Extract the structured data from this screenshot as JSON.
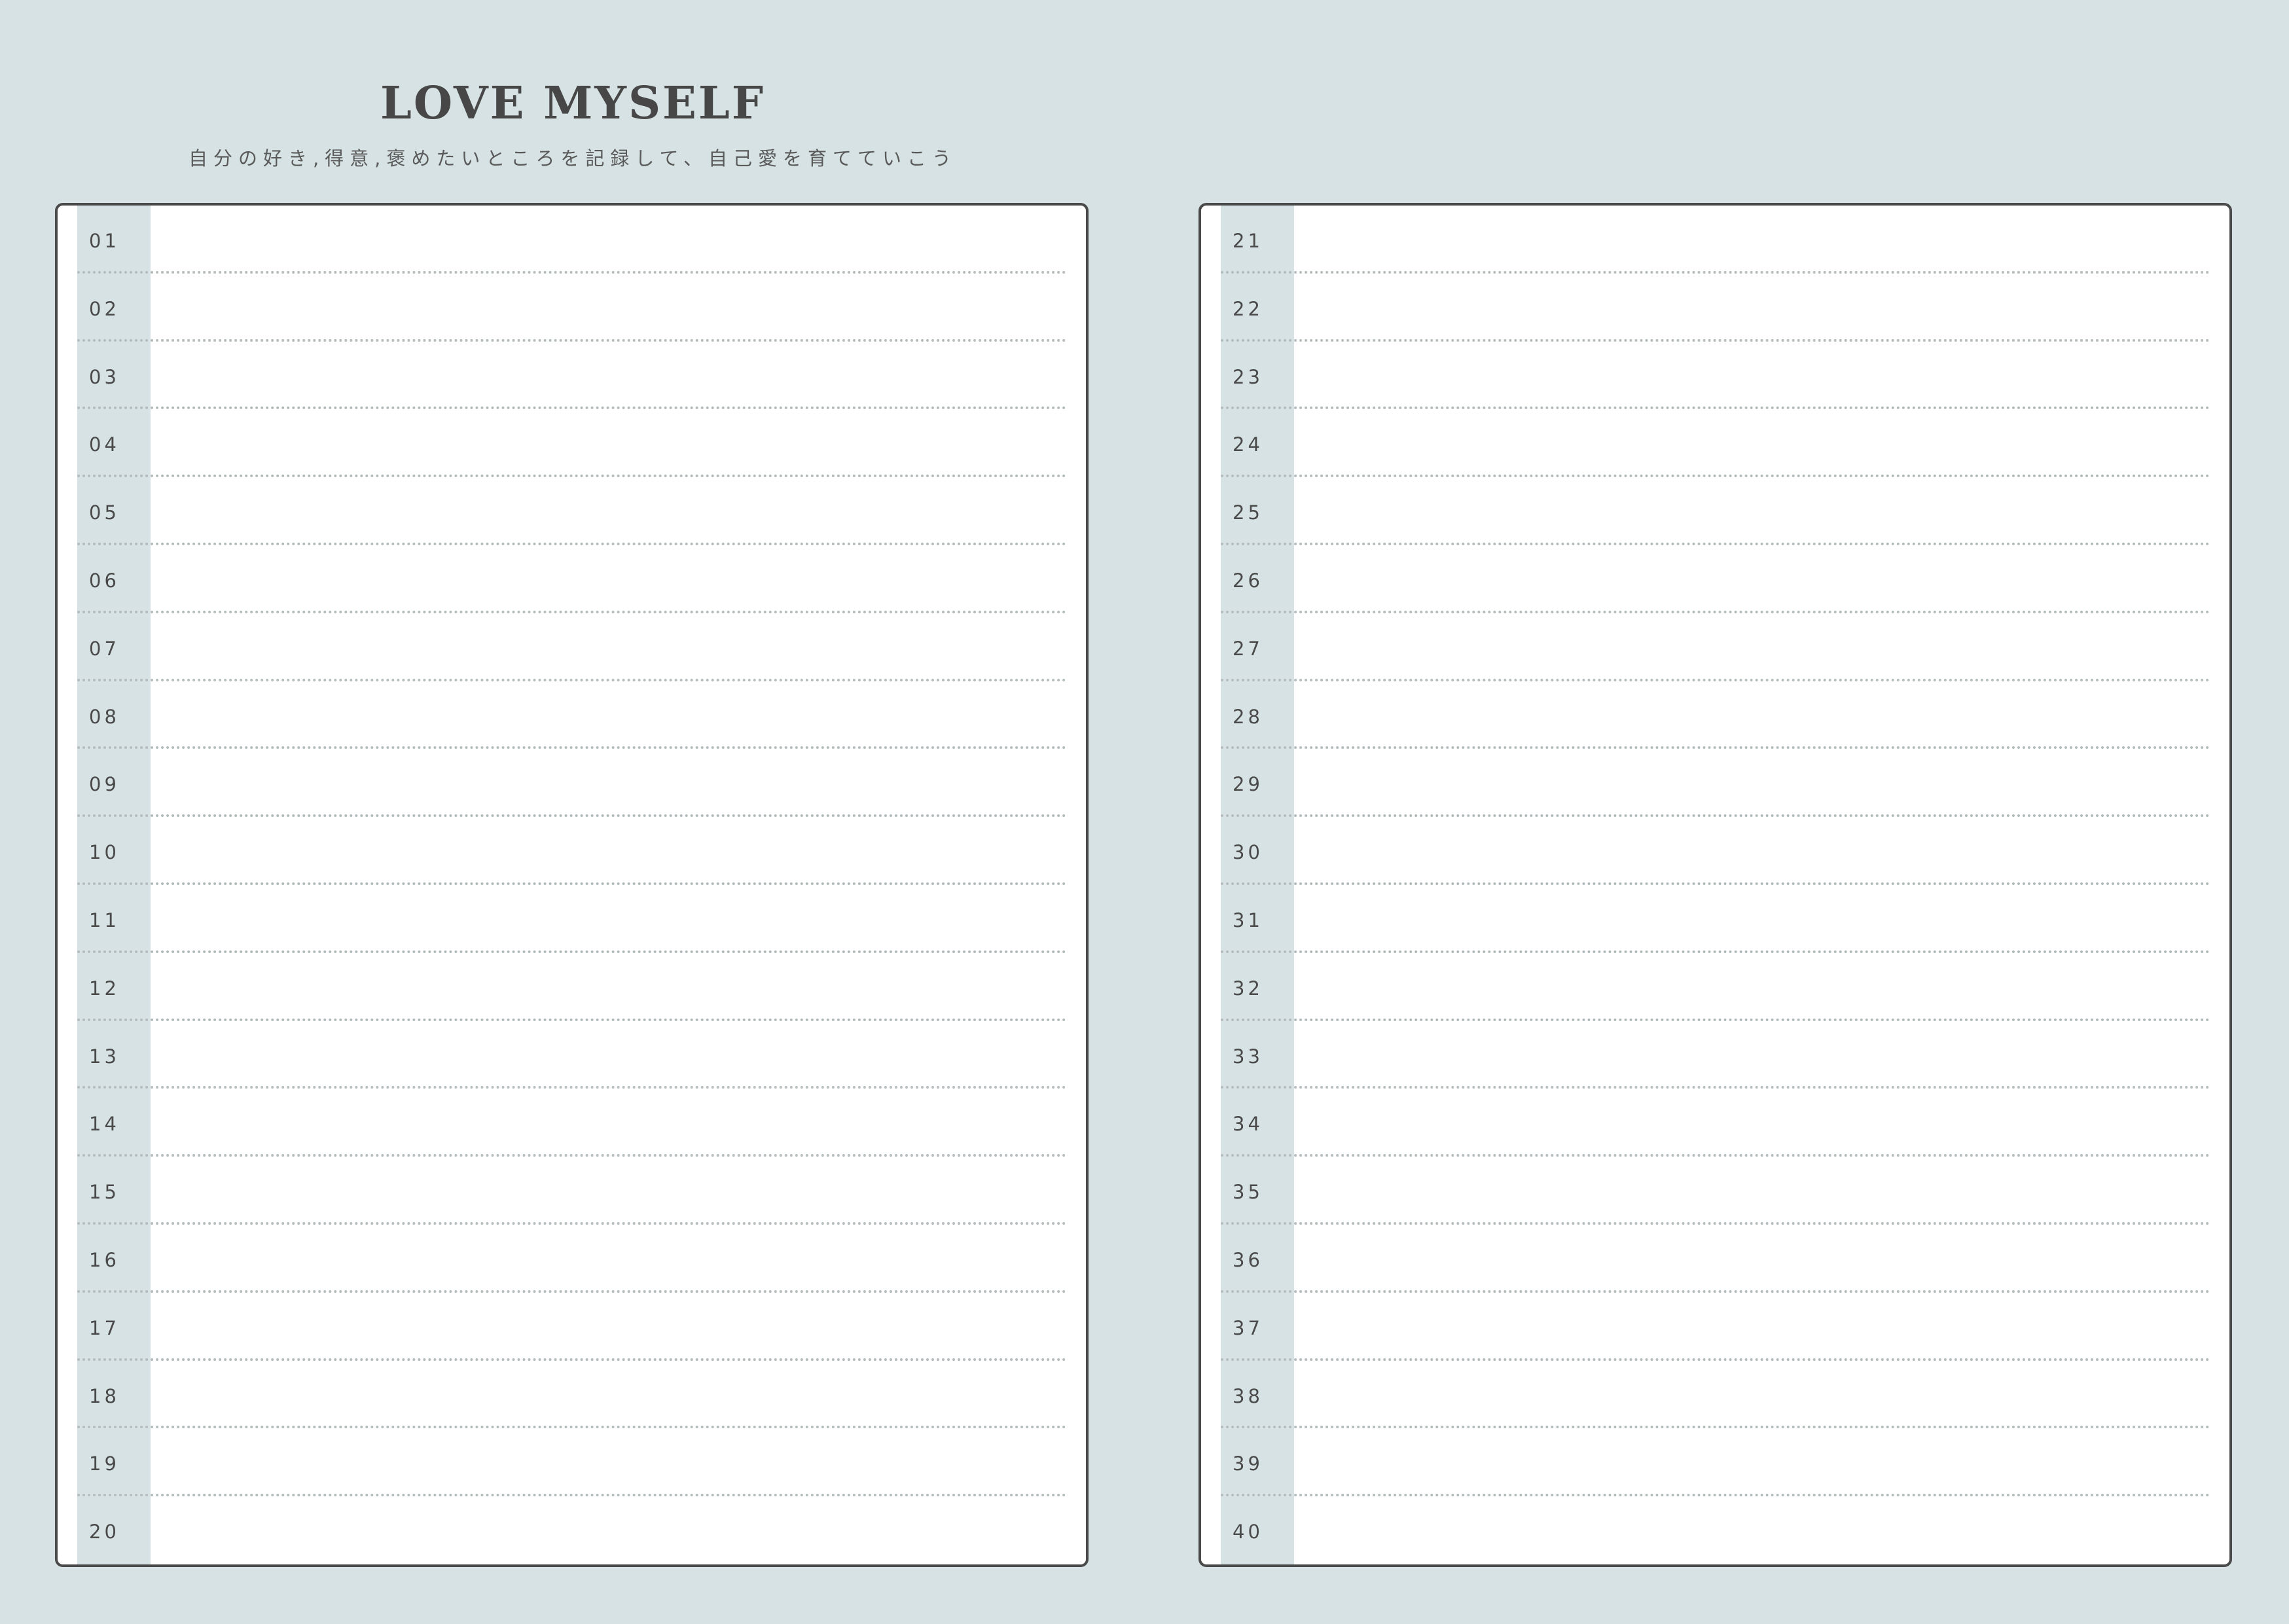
{
  "header": {
    "title": "LOVE MYSELF",
    "subtitle": "自分の好き,得意,褒めたいところを記録して、自己愛を育てていこう"
  },
  "colors": {
    "background": "#d6e2e3",
    "panel": "#ffffff",
    "border": "#4a4a4a",
    "text": "#4a4a4a",
    "dotted_rule": "#b5bcbe"
  },
  "panels": [
    {
      "id": "left",
      "rows": [
        "01",
        "02",
        "03",
        "04",
        "05",
        "06",
        "07",
        "08",
        "09",
        "10",
        "11",
        "12",
        "13",
        "14",
        "15",
        "16",
        "17",
        "18",
        "19",
        "20"
      ]
    },
    {
      "id": "right",
      "rows": [
        "21",
        "22",
        "23",
        "24",
        "25",
        "26",
        "27",
        "28",
        "29",
        "30",
        "31",
        "32",
        "33",
        "34",
        "35",
        "36",
        "37",
        "38",
        "39",
        "40"
      ]
    }
  ]
}
